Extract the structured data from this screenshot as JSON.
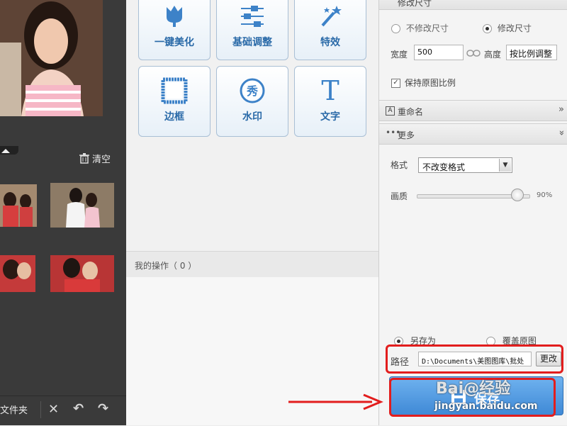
{
  "left_panel": {
    "clear_label": "清空",
    "folder_label": "文件夹"
  },
  "tools": [
    {
      "label": "一键美化",
      "icon": "tulip-icon"
    },
    {
      "label": "基础调整",
      "icon": "sliders-icon"
    },
    {
      "label": "特效",
      "icon": "magic-wand-icon"
    },
    {
      "label": "边框",
      "icon": "frame-icon"
    },
    {
      "label": "水印",
      "icon": "watermark-seal-icon",
      "glyph": "秀"
    },
    {
      "label": "文字",
      "icon": "text-icon",
      "glyph": "T"
    }
  ],
  "operations": {
    "label": "我的操作（ 0 ）"
  },
  "resize": {
    "section_title": "修改尺寸",
    "keep_size_label": "不修改尺寸",
    "change_size_label": "修改尺寸",
    "selected": "change",
    "width_label": "宽度",
    "width_value": "500",
    "height_label": "高度",
    "height_value": "按比例调整",
    "keep_ratio_label": "保持原图比例",
    "keep_ratio_checked": true
  },
  "rename": {
    "section_title": "重命名"
  },
  "more": {
    "section_title": "更多",
    "format_label": "格式",
    "format_value": "不改变格式",
    "quality_label": "画质",
    "quality_value": "90%",
    "quality_level": 0.9
  },
  "output": {
    "save_as_label": "另存为",
    "overwrite_label": "覆盖原图",
    "selected": "save_as",
    "path_label": "路径",
    "path_value": "D:\\Documents\\美图图库\\批处",
    "change_label": "更改",
    "save_label": "保存"
  },
  "watermark": {
    "top": "Bai@经验",
    "bottom": "jingyan.baidu.com"
  },
  "colors": {
    "accent": "#2a6aa8",
    "highlight": "#e21d1d",
    "save_button": "#4a93de"
  }
}
